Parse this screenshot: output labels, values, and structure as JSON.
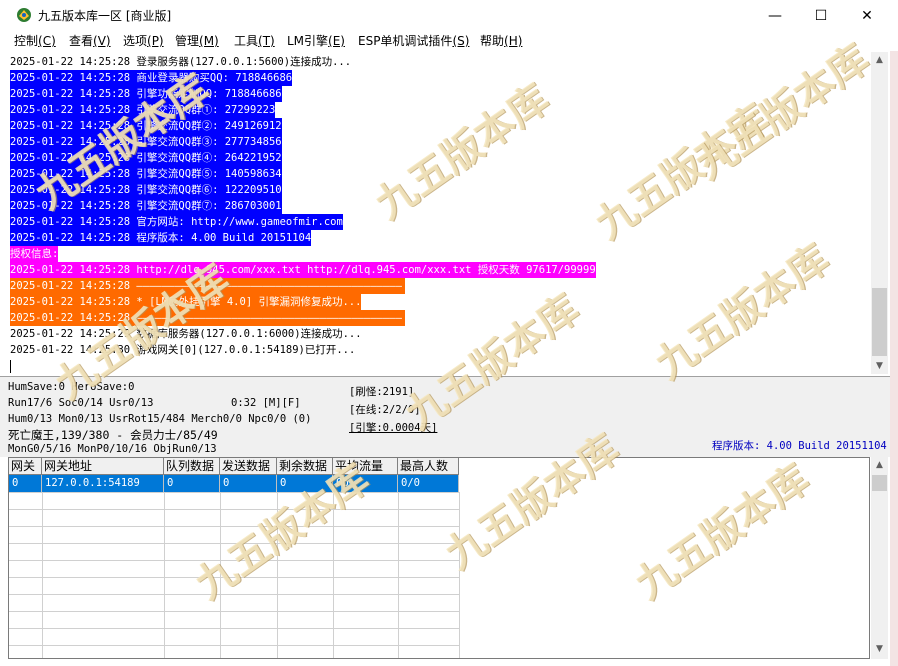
{
  "window": {
    "title": "九五版本库一区 [商业版]",
    "minimize_glyph": "—",
    "maximize_glyph": "☐",
    "close_glyph": "✕"
  },
  "menu": [
    {
      "label": "控制",
      "key": "(C)"
    },
    {
      "label": "查看",
      "key": "(V)"
    },
    {
      "label": "选项",
      "key": "(P)"
    },
    {
      "label": "管理",
      "key": "(M)"
    },
    {
      "label": "工具",
      "key": "(T)"
    },
    {
      "label": "LM引擎",
      "key": "(E)"
    },
    {
      "label": "ESP单机调试插件",
      "key": "(S)"
    },
    {
      "label": "帮助",
      "key": "(H)"
    }
  ],
  "log": [
    {
      "text": "2025-01-22 14:25:28 登录服务器(127.0.0.1:5600)连接成功...",
      "style": "normal"
    },
    {
      "text": "2025-01-22 14:25:28 商业登录器购买QQ: 718846686",
      "style": "sel"
    },
    {
      "text": "2025-01-22 14:25:28 引擎功能定制QQ: 718846686",
      "style": "sel"
    },
    {
      "text": "2025-01-22 14:25:28 引擎交流QQ群①: 27299223",
      "style": "sel"
    },
    {
      "text": "2025-01-22 14:25:28 引擎交流QQ群②: 249126912",
      "style": "sel"
    },
    {
      "text": "2025-01-22 14:25:28 引擎交流QQ群③: 277734856",
      "style": "sel"
    },
    {
      "text": "2025-01-22 14:25:28 引擎交流QQ群④: 264221952",
      "style": "sel"
    },
    {
      "text": "2025-01-22 14:25:28 引擎交流QQ群⑤: 140598634",
      "style": "sel"
    },
    {
      "text": "2025-01-22 14:25:28 引擎交流QQ群⑥: 122209510",
      "style": "sel"
    },
    {
      "text": "2025-01-22 14:25:28 引擎交流QQ群⑦: 286703001",
      "style": "sel"
    },
    {
      "text": "2025-01-22 14:25:28 官方网站: http://www.gameofmir.com",
      "style": "sel"
    },
    {
      "text": "2025-01-22 14:25:28 程序版本: 4.00 Build 20151104",
      "style": "sel"
    },
    {
      "text": "授权信息:",
      "style": "mag"
    },
    {
      "text": "2025-01-22 14:25:28 http://dlq.945.com/xxx.txt http://dlq.945.com/xxx.txt 授权天数 97617/99999",
      "style": "mag"
    },
    {
      "text": "2025-01-22 14:25:28 ——————————————————————————————————————————",
      "style": "org"
    },
    {
      "text": "2025-01-22 14:25:28 * [LM反外挂引擎 4.0] 引擎漏洞修复成功...",
      "style": "org"
    },
    {
      "text": "2025-01-22 14:25:28 ——————————————————————————————————————————",
      "style": "org"
    },
    {
      "text": "2025-01-22 14:25:29 数据库服务器(127.0.0.1:6000)连接成功...",
      "style": "normal"
    },
    {
      "text": "2025-01-22 14:25:30 游戏网关[0](127.0.0.1:54189)已打开...",
      "style": "normal"
    }
  ],
  "status": {
    "line1": "HumSave:0 HeroSave:0",
    "line2": "Run17/6 Soc0/14 Usr0/13",
    "timer": "0:32 [M][F]",
    "line3": "Hum0/13 Mon0/13 UsrRot15/484 Merch0/0 Npc0/0 (0)",
    "line4": "死亡魔王,139/380 - 会员力士/85/49",
    "line5": "MonG0/5/16 MonP0/10/16 ObjRun0/13",
    "refresh": "[刷怪:2191]",
    "online": "[在线:2/2/0]",
    "engine": "[引擎:0.0004天]",
    "version": "程序版本: 4.00 Build 20151104"
  },
  "grid": {
    "headers": [
      "网关",
      "网关地址",
      "队列数据",
      "发送数据",
      "剩余数据",
      "平均流量",
      "最高人数"
    ],
    "rows": [
      [
        "0",
        "127.0.0.1:54189",
        "0",
        "0",
        "0",
        "0b",
        "0/0"
      ]
    ]
  },
  "watermark": {
    "text": "九五版本库"
  },
  "colors": {
    "selection": "#0000ff",
    "auth": "#ff00ff",
    "orange": "#ff6a00",
    "version": "#0000c0"
  }
}
